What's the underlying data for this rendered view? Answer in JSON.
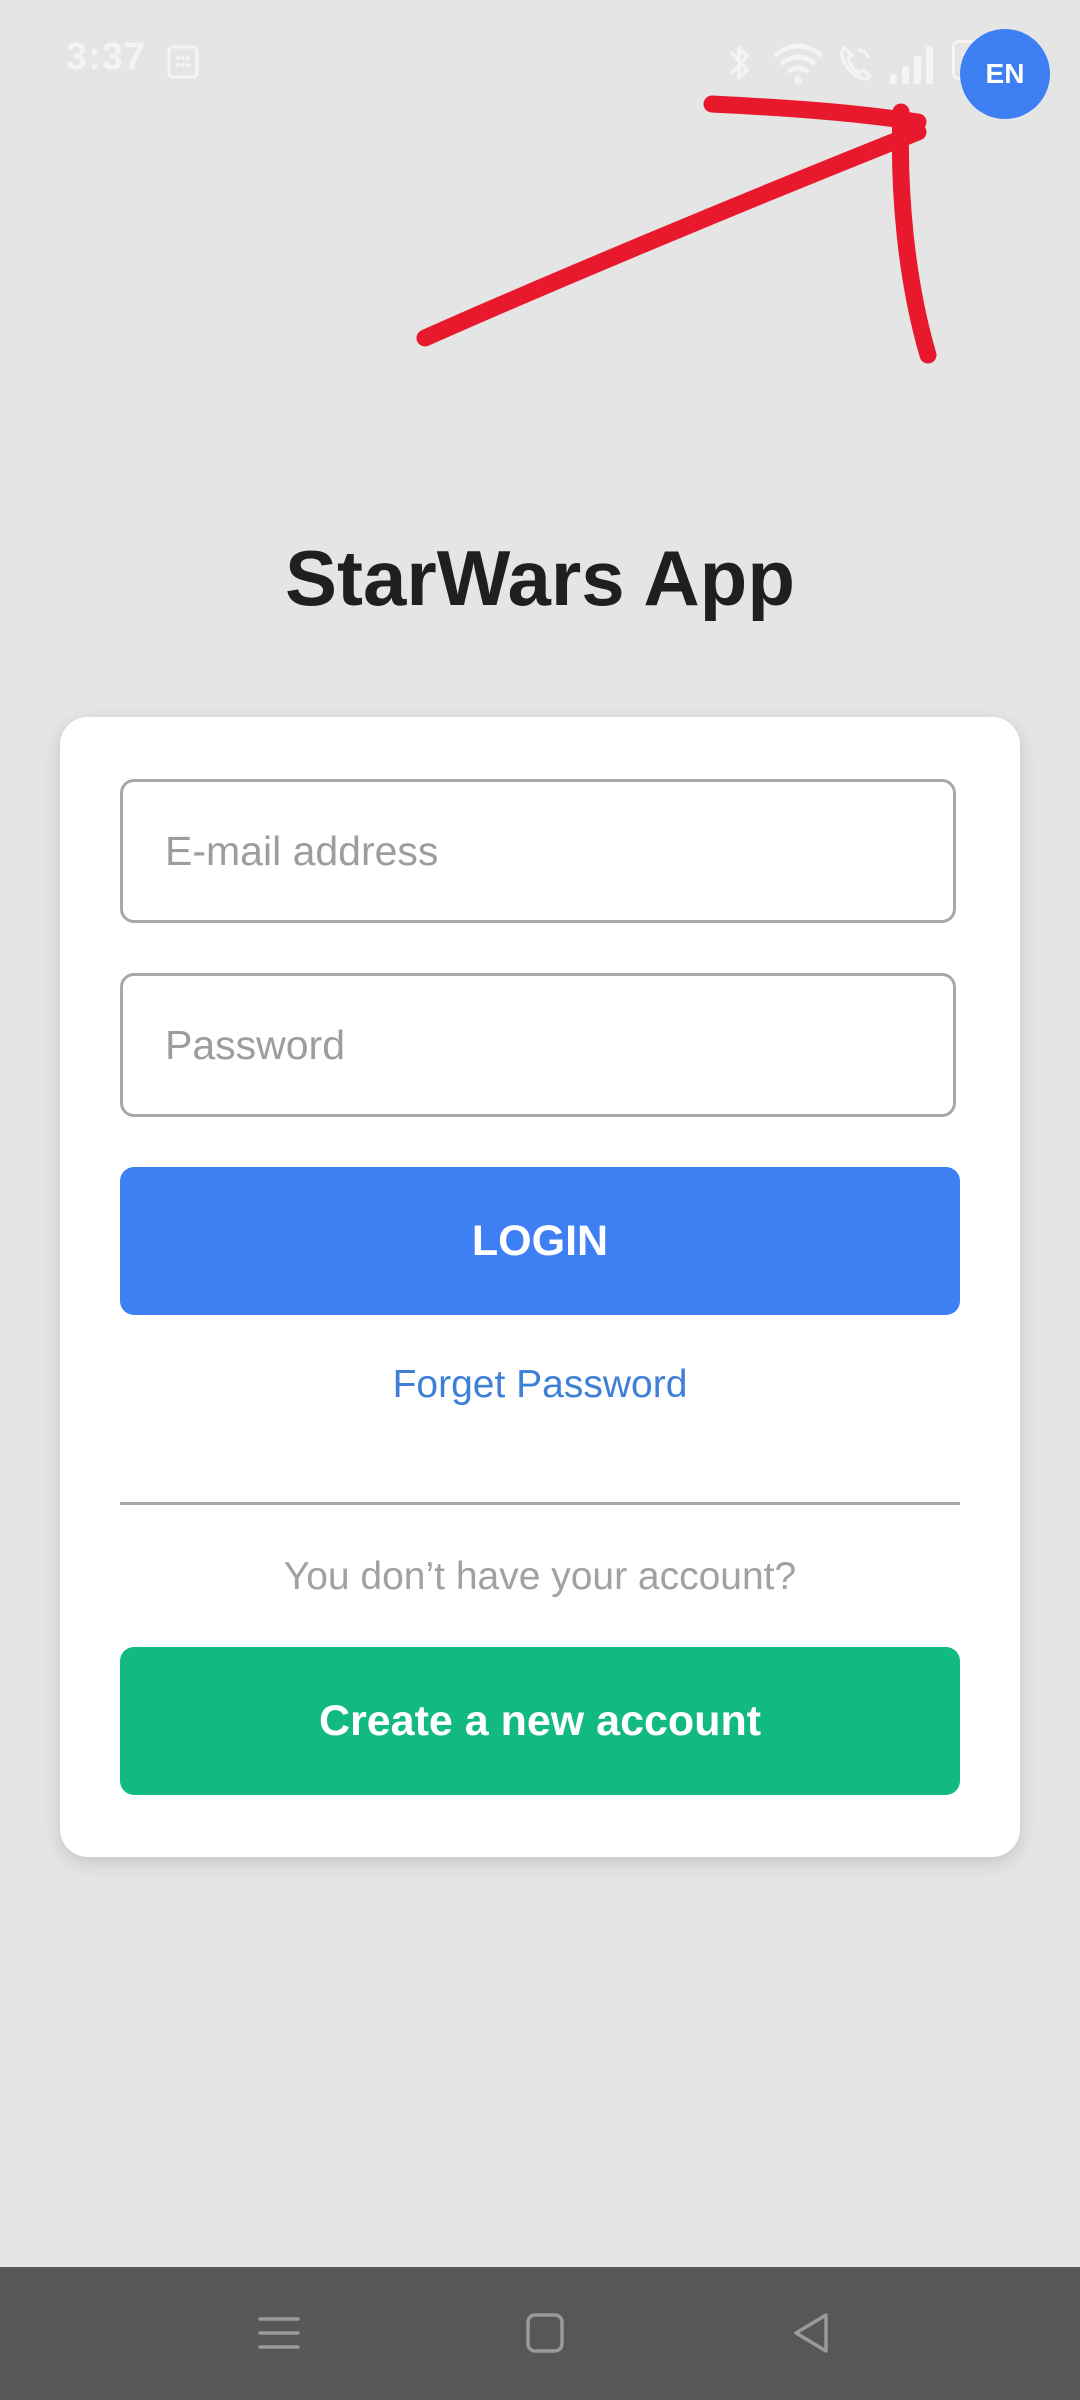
{
  "status_bar": {
    "time": "3:37",
    "icons": [
      "sim-card-icon",
      "bluetooth-icon",
      "wifi-icon",
      "wifi-call-icon",
      "signal-icon",
      "battery-icon"
    ],
    "battery": "100"
  },
  "language_button": {
    "label": "EN",
    "color": "#3d7ff2"
  },
  "annotation": {
    "color": "#e8192c",
    "icon": "red-arrow-annotation"
  },
  "app_title": "StarWars App",
  "login_form": {
    "email_placeholder": "E-mail address",
    "password_placeholder": "Password",
    "login_label": "LOGIN",
    "forget_password_label": "Forget Password",
    "no_account_text": "You don’t have your account?",
    "create_account_label": "Create a new account"
  },
  "colors": {
    "background": "#e5e5e6",
    "login_button": "#3e80f4",
    "create_button": "#13ba80",
    "link": "#3e80d8",
    "nav_bar": "#575757"
  },
  "nav_bar": {
    "icons": [
      "menu-icon",
      "home-icon",
      "back-icon"
    ]
  }
}
